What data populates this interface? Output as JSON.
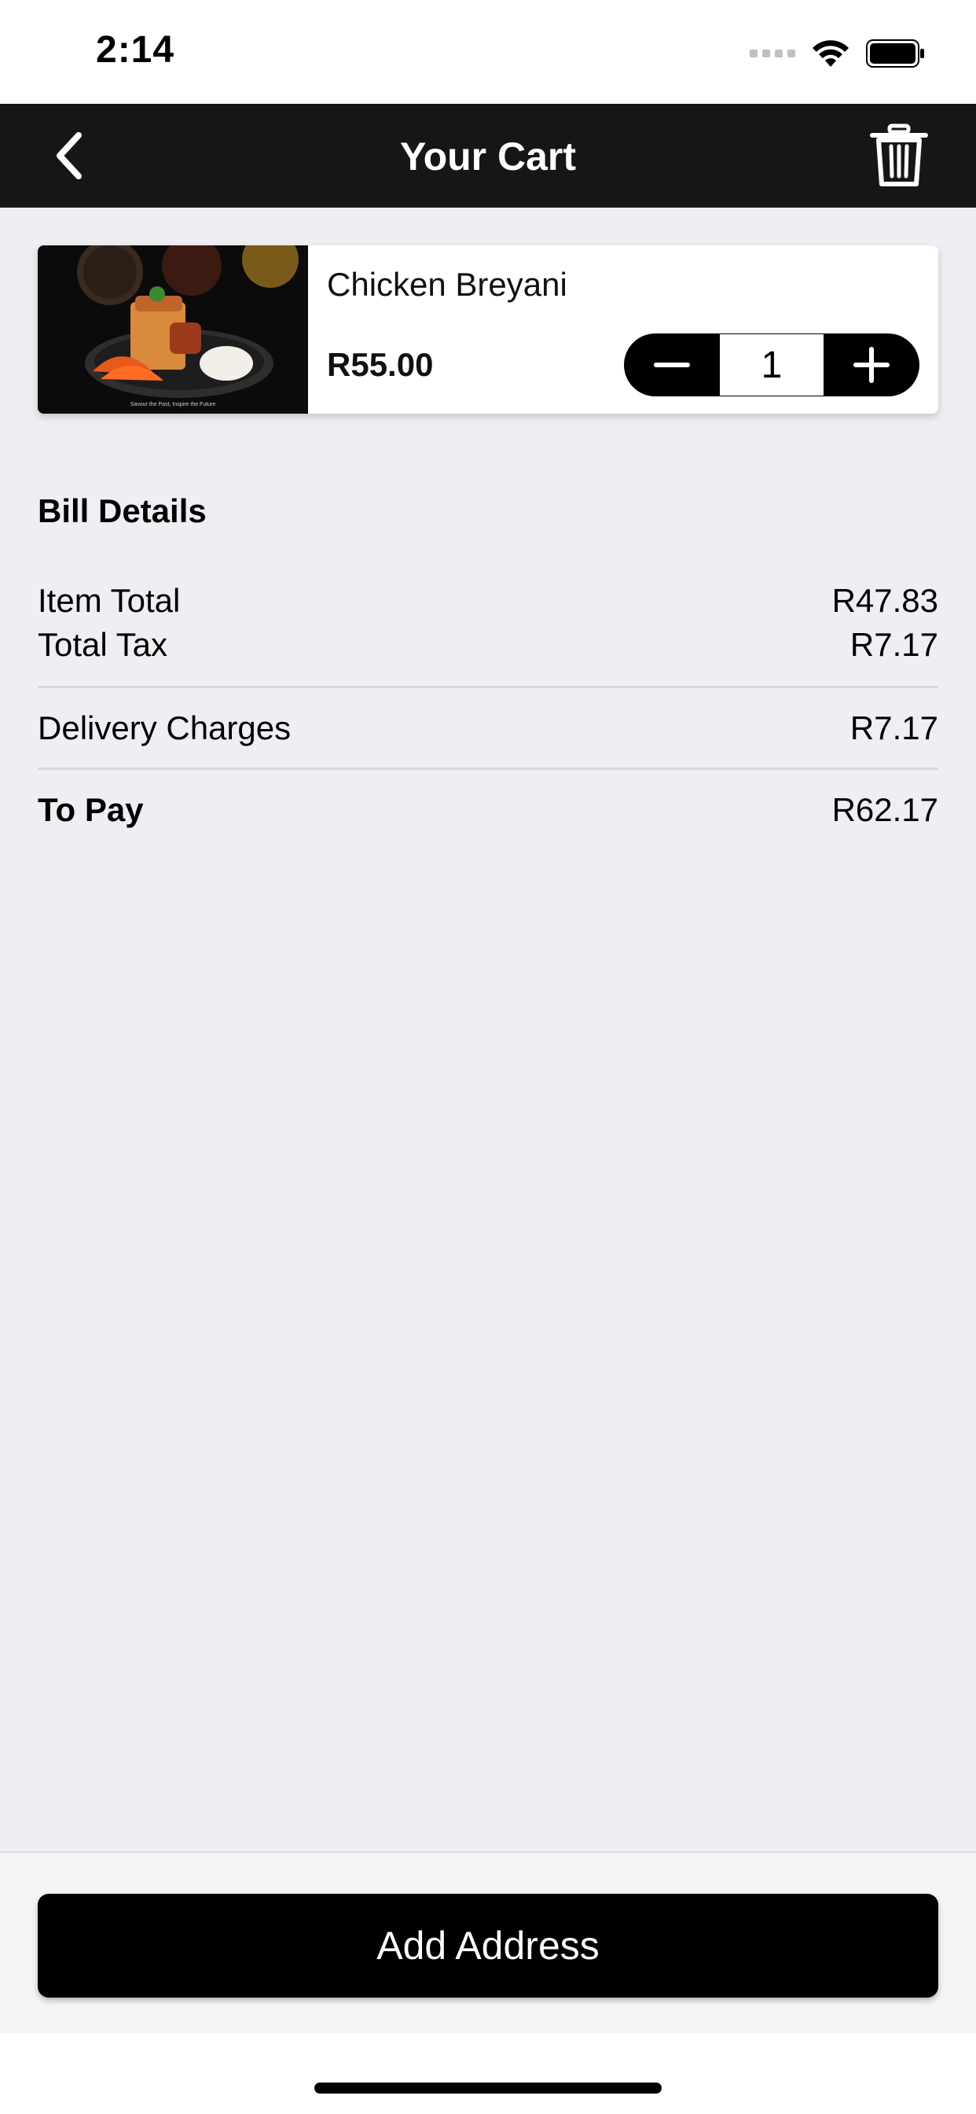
{
  "status_bar": {
    "time": "2:14"
  },
  "nav": {
    "title": "Your Cart",
    "back_icon": "chevron-left-icon",
    "trash_icon": "trash-icon"
  },
  "cart_item": {
    "name": "Chicken Breyani",
    "price": "R55.00",
    "quantity": "1",
    "image_caption": "Savour the Past, Inspire the Future"
  },
  "bill": {
    "title": "Bill Details",
    "rows": [
      {
        "label": "Item Total",
        "value": "R47.83"
      },
      {
        "label": "Total Tax",
        "value": "R7.17"
      },
      {
        "label": "Delivery Charges",
        "value": "R7.17"
      },
      {
        "label": "To Pay",
        "value": "R62.17"
      }
    ]
  },
  "footer": {
    "button_label": "Add Address"
  },
  "colors": {
    "nav_bg": "#161616",
    "page_bg": "#EFEEF3",
    "button_bg": "#000000"
  }
}
